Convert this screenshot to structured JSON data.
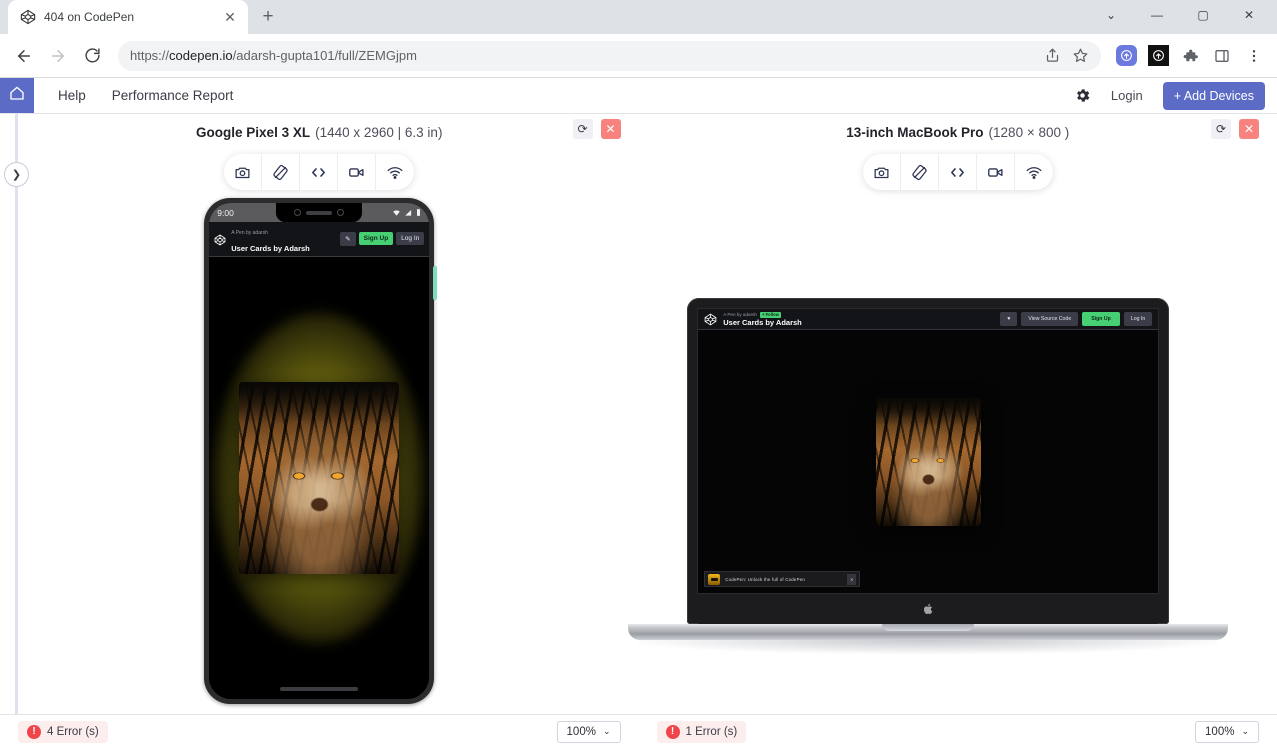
{
  "browser": {
    "tab": {
      "title": "404 on CodePen",
      "favicon_icon": "codepen-logo-icon",
      "close_icon": "✕"
    },
    "new_tab_icon": "+",
    "window_controls": {
      "minimize": "—",
      "maximize": "▢",
      "close": "✕",
      "chevron": "⌄"
    },
    "nav": {
      "back_icon": "←",
      "forward_icon": "→",
      "reload_icon": "⟳"
    },
    "omnibox": {
      "url_scheme": "https://",
      "url_host": "codepen.io",
      "url_path": "/adarsh-gupta101/full/ZEMGjpm",
      "share_icon": "share-icon",
      "bookmark_icon": "star-icon"
    },
    "extensions": [
      "browserstack-icon",
      "selenium-icon",
      "puzzle-icon",
      "sidepanel-icon",
      "menu-icon"
    ]
  },
  "app_header": {
    "home_icon": "home-icon",
    "nav_items": [
      {
        "label": "Help"
      },
      {
        "label": "Performance Report"
      }
    ],
    "gear_icon": "gear-icon",
    "login_label": "Login",
    "add_devices_label": "+ Add Devices",
    "accent_color": "#5c6bc6"
  },
  "sidebar_toggle": {
    "icon": "chevron-right-icon"
  },
  "tool_icons": [
    {
      "name": "camera-icon",
      "title": "Screenshot"
    },
    {
      "name": "rotate-device-icon",
      "title": "Rotate"
    },
    {
      "name": "code-icon",
      "title": "Inspect"
    },
    {
      "name": "video-icon",
      "title": "Record"
    },
    {
      "name": "wifi-icon",
      "title": "Network"
    }
  ],
  "panels": [
    {
      "device_name": "Google Pixel 3 XL",
      "device_spec": "(1440 x 2960 | 6.3 in)",
      "rotate_icon": "⟳",
      "close_icon": "✕",
      "footer": {
        "error_badge": "!",
        "error_text": "4 Error (s)",
        "zoom_value": "100%",
        "zoom_caret": "⌄"
      },
      "status_bar": {
        "time": "9:00",
        "wifi_icon": "▼",
        "signal_icon": "◢",
        "battery_icon": "▮"
      },
      "page": {
        "pen_by": "A Pen by adarsh",
        "pen_title": "User Cards by Adarsh",
        "edit_label": "✎",
        "signup_label": "Sign Up",
        "login_label": "Log In"
      }
    },
    {
      "device_name": "13-inch MacBook Pro",
      "device_spec": "(1280 × 800 )",
      "rotate_icon": "⟳",
      "close_icon": "✕",
      "footer": {
        "error_badge": "!",
        "error_text": "1 Error (s)",
        "zoom_value": "100%",
        "zoom_caret": "⌄"
      },
      "page": {
        "pen_by": "A Pen by adarsh",
        "follow_badge": "+ Follow",
        "pen_title": "User Cards by Adarsh",
        "heart_label": "♥",
        "view_source_label": "View Source Code",
        "signup_label": "Sign Up",
        "login_label": "Log In",
        "banner_text": "CodePen: Unlock the full of CodePen",
        "banner_close": "✕"
      }
    }
  ]
}
